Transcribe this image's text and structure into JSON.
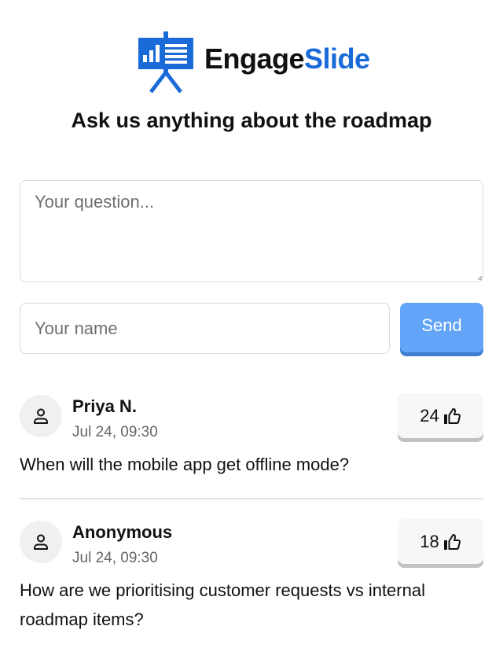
{
  "brand": {
    "name_part1": "Engage",
    "name_part2": "Slide",
    "color_dark": "#111111",
    "color_blue": "#1a6bd8"
  },
  "headline": "Ask us anything about the roadmap",
  "form": {
    "question_placeholder": "Your question...",
    "name_placeholder": "Your name",
    "send_label": "Send",
    "send_color": "#62a4f7"
  },
  "questions": [
    {
      "author": "Priya N.",
      "time": "Jul 24, 09:30",
      "text": "When will the mobile app get offline mode?",
      "votes": "24",
      "avatar_icon": "user-icon",
      "vote_icon": "thumbs-up-icon"
    },
    {
      "author": "Anonymous",
      "time": "Jul 24, 09:30",
      "text": "How are we prioritising customer requests vs internal roadmap items?",
      "votes": "18",
      "avatar_icon": "user-icon",
      "vote_icon": "thumbs-up-icon"
    }
  ]
}
